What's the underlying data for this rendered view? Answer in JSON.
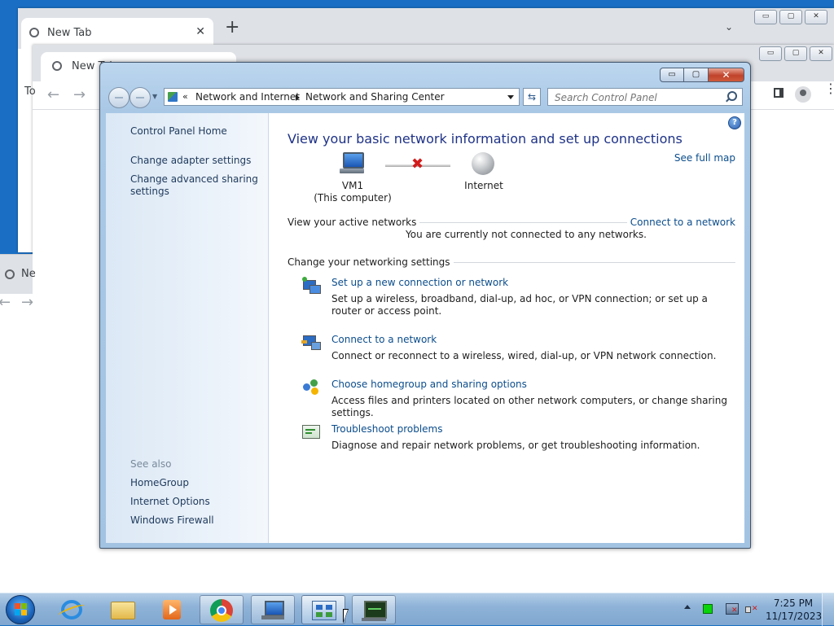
{
  "browser_back": {
    "tab_title": "New Tab",
    "tab_close": "✕",
    "new_tab": "+",
    "tab_search": "⌄",
    "window_controls": [
      "▭",
      "▢",
      "✕"
    ]
  },
  "browser_middle": {
    "tab_title": "New Tab",
    "bookmark_stub": "To",
    "window_controls": [
      "▭",
      "▢",
      "✕"
    ],
    "nav": {
      "back": "←",
      "forward": "→"
    },
    "menu": "⋮"
  },
  "browser_left": {
    "tab_title": "Ne",
    "nav": {
      "back": "←",
      "forward": "→"
    }
  },
  "control_panel": {
    "window_controls": {
      "minimize": "▭",
      "maximize": "▢",
      "close": "✕"
    },
    "address": {
      "chevron": "«",
      "crumbs": [
        "Network and Internet",
        "Network and Sharing Center"
      ]
    },
    "refresh_symbol": "⇆",
    "search_placeholder": "Search Control Panel",
    "help_symbol": "?",
    "left_pane": {
      "home": "Control Panel Home",
      "links": [
        "Change adapter settings",
        "Change advanced sharing settings"
      ],
      "see_also_heading": "See also",
      "see_also": [
        "HomeGroup",
        "Internet Options",
        "Windows Firewall"
      ]
    },
    "main": {
      "title": "View your basic network information and set up connections",
      "see_full_map": "See full map",
      "map": {
        "computer_name": "VM1",
        "computer_sub": "(This computer)",
        "status_symbol": "✖",
        "internet": "Internet"
      },
      "active_networks_heading": "View your active networks",
      "connect_link": "Connect to a network",
      "not_connected_text": "You are currently not connected to any networks.",
      "settings_heading": "Change your networking settings",
      "tasks": [
        {
          "link": "Set up a new connection or network",
          "desc": "Set up a wireless, broadband, dial-up, ad hoc, or VPN connection; or set up a router or access point.",
          "icon": "new-connection-icon"
        },
        {
          "link": "Connect to a network",
          "desc": "Connect or reconnect to a wireless, wired, dial-up, or VPN network connection.",
          "icon": "connect-network-icon"
        },
        {
          "link": "Choose homegroup and sharing options",
          "desc": "Access files and printers located on other network computers, or change sharing settings.",
          "icon": "homegroup-icon"
        },
        {
          "link": "Troubleshoot problems",
          "desc": "Diagnose and repair network problems, or get troubleshooting information.",
          "icon": "troubleshoot-icon"
        }
      ]
    }
  },
  "taskbar": {
    "clock_time": "7:25 PM",
    "clock_date": "11/17/2023",
    "pinned": [
      "start-orb",
      "internet-explorer-icon",
      "file-explorer-icon",
      "media-player-icon",
      "chrome-icon"
    ],
    "open": [
      "network-window-icon",
      "control-panel-icon",
      "diagnostics-icon"
    ]
  },
  "colors": {
    "desktop": "#1a6fc4",
    "link": "#0b4d8c",
    "title": "#1e3287",
    "error_x": "#d21b1b"
  }
}
